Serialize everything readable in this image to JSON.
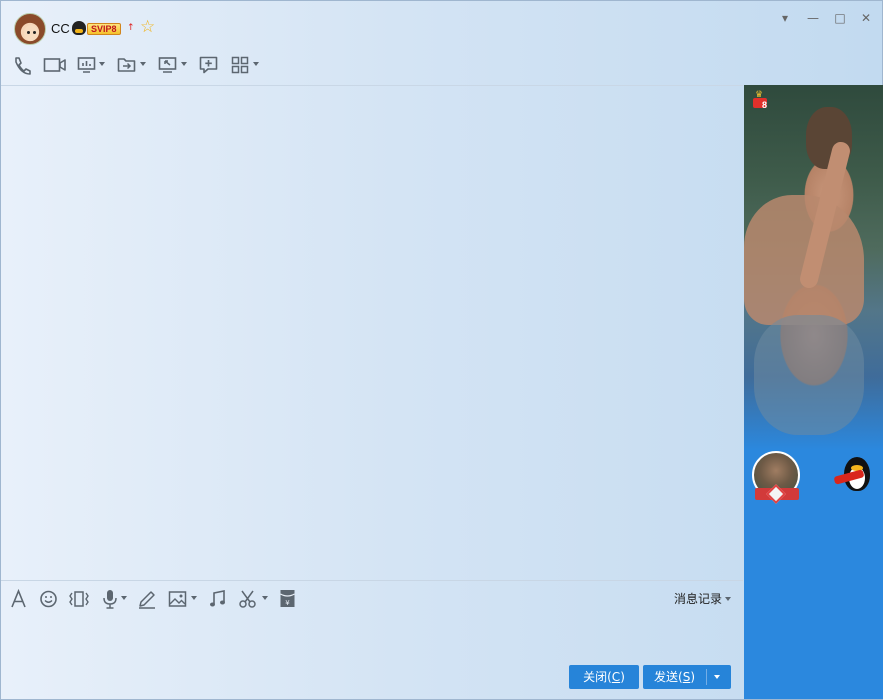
{
  "window": {
    "contact_name": "CC",
    "vip_badge": "SVIP8",
    "vip_arrow": "↑",
    "star_glyph": "☆"
  },
  "window_controls": {
    "dropdown": "▾",
    "minimize": "—",
    "maximize": "□",
    "close": "✕"
  },
  "top_toolbar": {
    "icons": [
      "phone-icon",
      "video-call-icon",
      "screen-share-icon",
      "file-transfer-icon",
      "remote-assist-icon",
      "new-chat-icon",
      "apps-grid-icon"
    ]
  },
  "input_toolbar": {
    "icons": [
      "font-icon",
      "emoji-icon",
      "shake-window-icon",
      "voice-message-icon",
      "doodle-icon",
      "image-icon",
      "music-icon",
      "screenshot-icon",
      "red-packet-icon"
    ],
    "history_label": "消息记录"
  },
  "actions": {
    "close_label": "关闭(",
    "close_hotkey": "C",
    "close_tail": ")",
    "send_label": "发送(",
    "send_hotkey": "S",
    "send_tail": ")"
  },
  "side_panel": {
    "gift_count": "8"
  },
  "colors": {
    "accent": "#2684d9",
    "panel_blue": "#2b88de",
    "icon_gray": "#5c6670"
  }
}
